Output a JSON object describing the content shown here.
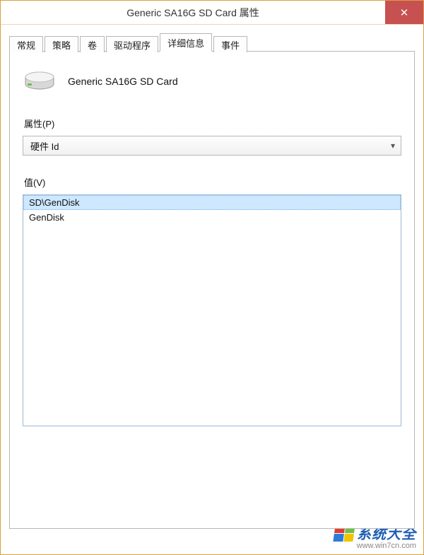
{
  "window": {
    "title": "Generic SA16G SD Card 属性",
    "close_symbol": "✕"
  },
  "tabs": [
    {
      "label": "常规"
    },
    {
      "label": "策略"
    },
    {
      "label": "卷"
    },
    {
      "label": "驱动程序"
    },
    {
      "label": "详细信息"
    },
    {
      "label": "事件"
    }
  ],
  "device": {
    "name": "Generic SA16G SD Card"
  },
  "property": {
    "label": "属性(P)",
    "selected": "硬件 Id"
  },
  "value": {
    "label": "值(V)",
    "items": [
      "SD\\GenDisk",
      "GenDisk"
    ]
  },
  "watermark": {
    "text": "系统大全",
    "url": "www.win7cn.com"
  }
}
